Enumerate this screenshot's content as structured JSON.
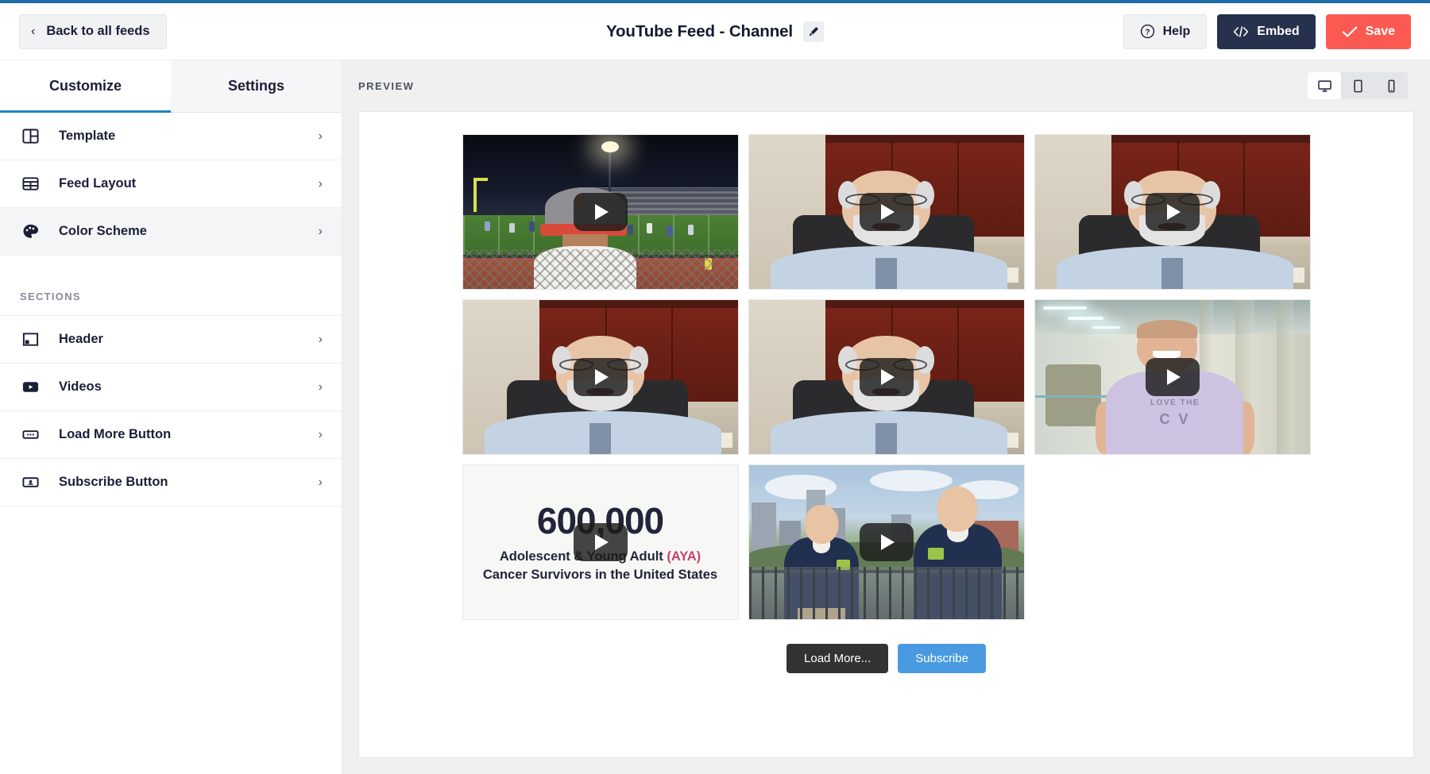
{
  "topbar": {
    "back_label": "Back to all feeds",
    "back_chevron": "chevron-left-icon",
    "feed_title": "YouTube Feed - Channel",
    "edit_icon": "pencil-icon",
    "help_label": "Help",
    "help_icon": "question-circle-icon",
    "embed_label": "Embed",
    "embed_icon": "code-icon",
    "save_label": "Save",
    "save_icon": "check-icon"
  },
  "colors": {
    "accent_blue": "#1b84c4",
    "top_border": "#1b6ca8",
    "embed_bg": "#26314e",
    "save_bg": "#fb5a52",
    "load_more_bg": "#333333",
    "subscribe_bg": "#4a9ae1",
    "sidebar_active_bg": "#f4f5f7",
    "text_dark": "#1a1f36"
  },
  "sidebar": {
    "tabs": [
      {
        "label": "Customize",
        "active": true
      },
      {
        "label": "Settings",
        "active": false
      }
    ],
    "primary_items": [
      {
        "label": "Template",
        "icon": "template-layout-icon",
        "active": false,
        "arrow": "chevron-right-icon"
      },
      {
        "label": "Feed Layout",
        "icon": "grid-layout-icon",
        "active": false,
        "arrow": "chevron-right-icon"
      },
      {
        "label": "Color Scheme",
        "icon": "palette-icon",
        "active": true,
        "arrow": "chevron-right-icon"
      }
    ],
    "sections_heading": "SECTIONS",
    "section_items": [
      {
        "label": "Header",
        "icon": "header-block-icon",
        "arrow": "chevron-right-icon"
      },
      {
        "label": "Videos",
        "icon": "youtube-play-icon",
        "arrow": "chevron-right-icon"
      },
      {
        "label": "Load More Button",
        "icon": "load-more-icon",
        "arrow": "chevron-right-icon"
      },
      {
        "label": "Subscribe Button",
        "icon": "subscribe-icon",
        "arrow": "chevron-right-icon"
      }
    ]
  },
  "preview": {
    "label": "PREVIEW",
    "devices": [
      {
        "name": "desktop-view-button",
        "icon": "monitor-icon",
        "active": true
      },
      {
        "name": "tablet-view-button",
        "icon": "tablet-icon",
        "active": false
      },
      {
        "name": "mobile-view-button",
        "icon": "mobile-icon",
        "active": false
      }
    ],
    "videos": [
      {
        "scene": "football-night-game",
        "alt": "Night high school football game from the stands",
        "play_icon": "play-button-icon"
      },
      {
        "scene": "office-man-1",
        "alt": "Bearded man with glasses in office with wooden cabinets",
        "play_icon": "play-button-icon"
      },
      {
        "scene": "office-man-2",
        "alt": "Bearded man with glasses in office with wooden cabinets",
        "play_icon": "play-button-icon"
      },
      {
        "scene": "office-man-3",
        "alt": "Bearded man with glasses in office with wooden cabinets",
        "play_icon": "play-button-icon"
      },
      {
        "scene": "office-man-4",
        "alt": "Bearded man with glasses in office with wooden cabinets",
        "play_icon": "play-button-icon"
      },
      {
        "scene": "corridor-purple-shirt",
        "alt": "Smiling man in purple LOVE THE COV t-shirt in a corridor",
        "play_icon": "play-button-icon"
      },
      {
        "scene": "infographic-600000",
        "alt": "600,000 AYA cancer survivors infographic",
        "play_icon": "play-button-icon"
      },
      {
        "scene": "two-men-city",
        "alt": "Two men in navy polo shirts with city skyline",
        "play_icon": "play-button-icon"
      }
    ],
    "infographic": {
      "number": "600,000",
      "line1_pre": "Adolescent & Young Adult ",
      "line1_aya": "(AYA)",
      "line2": "Cancer Survivors in the United States"
    },
    "shirt_text": {
      "top": "LOVE THE",
      "bottom": "C  V"
    },
    "footer": {
      "load_more_label": "Load More...",
      "subscribe_label": "Subscribe"
    }
  }
}
